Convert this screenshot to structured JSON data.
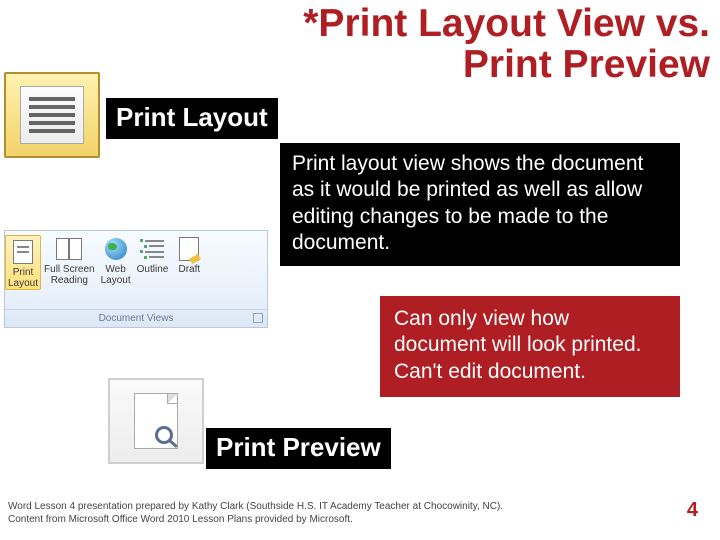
{
  "title_line1": "*Print Layout View vs.",
  "title_line2": "Print Preview",
  "print_layout_label": "Print Layout",
  "desc_black": "Print layout view shows the document as it would be printed as well as allow editing changes to be made to the document.",
  "ribbon": {
    "group_label": "Document Views",
    "items": [
      {
        "label_top": "Print",
        "label_bottom": "Layout"
      },
      {
        "label_top": "Full Screen",
        "label_bottom": "Reading"
      },
      {
        "label_top": "Web",
        "label_bottom": "Layout"
      },
      {
        "label_top": "Outline",
        "label_bottom": ""
      },
      {
        "label_top": "Draft",
        "label_bottom": ""
      }
    ]
  },
  "desc_red": "Can only view how document will look printed. Can't edit document.",
  "print_preview_label": "Print Preview",
  "footer": "Word Lesson 4 presentation prepared by Kathy Clark (Southside H.S. IT Academy Teacher at Chocowinity, NC). Content from Microsoft Office Word 2010 Lesson Plans provided by Microsoft.",
  "slide_number": "4"
}
